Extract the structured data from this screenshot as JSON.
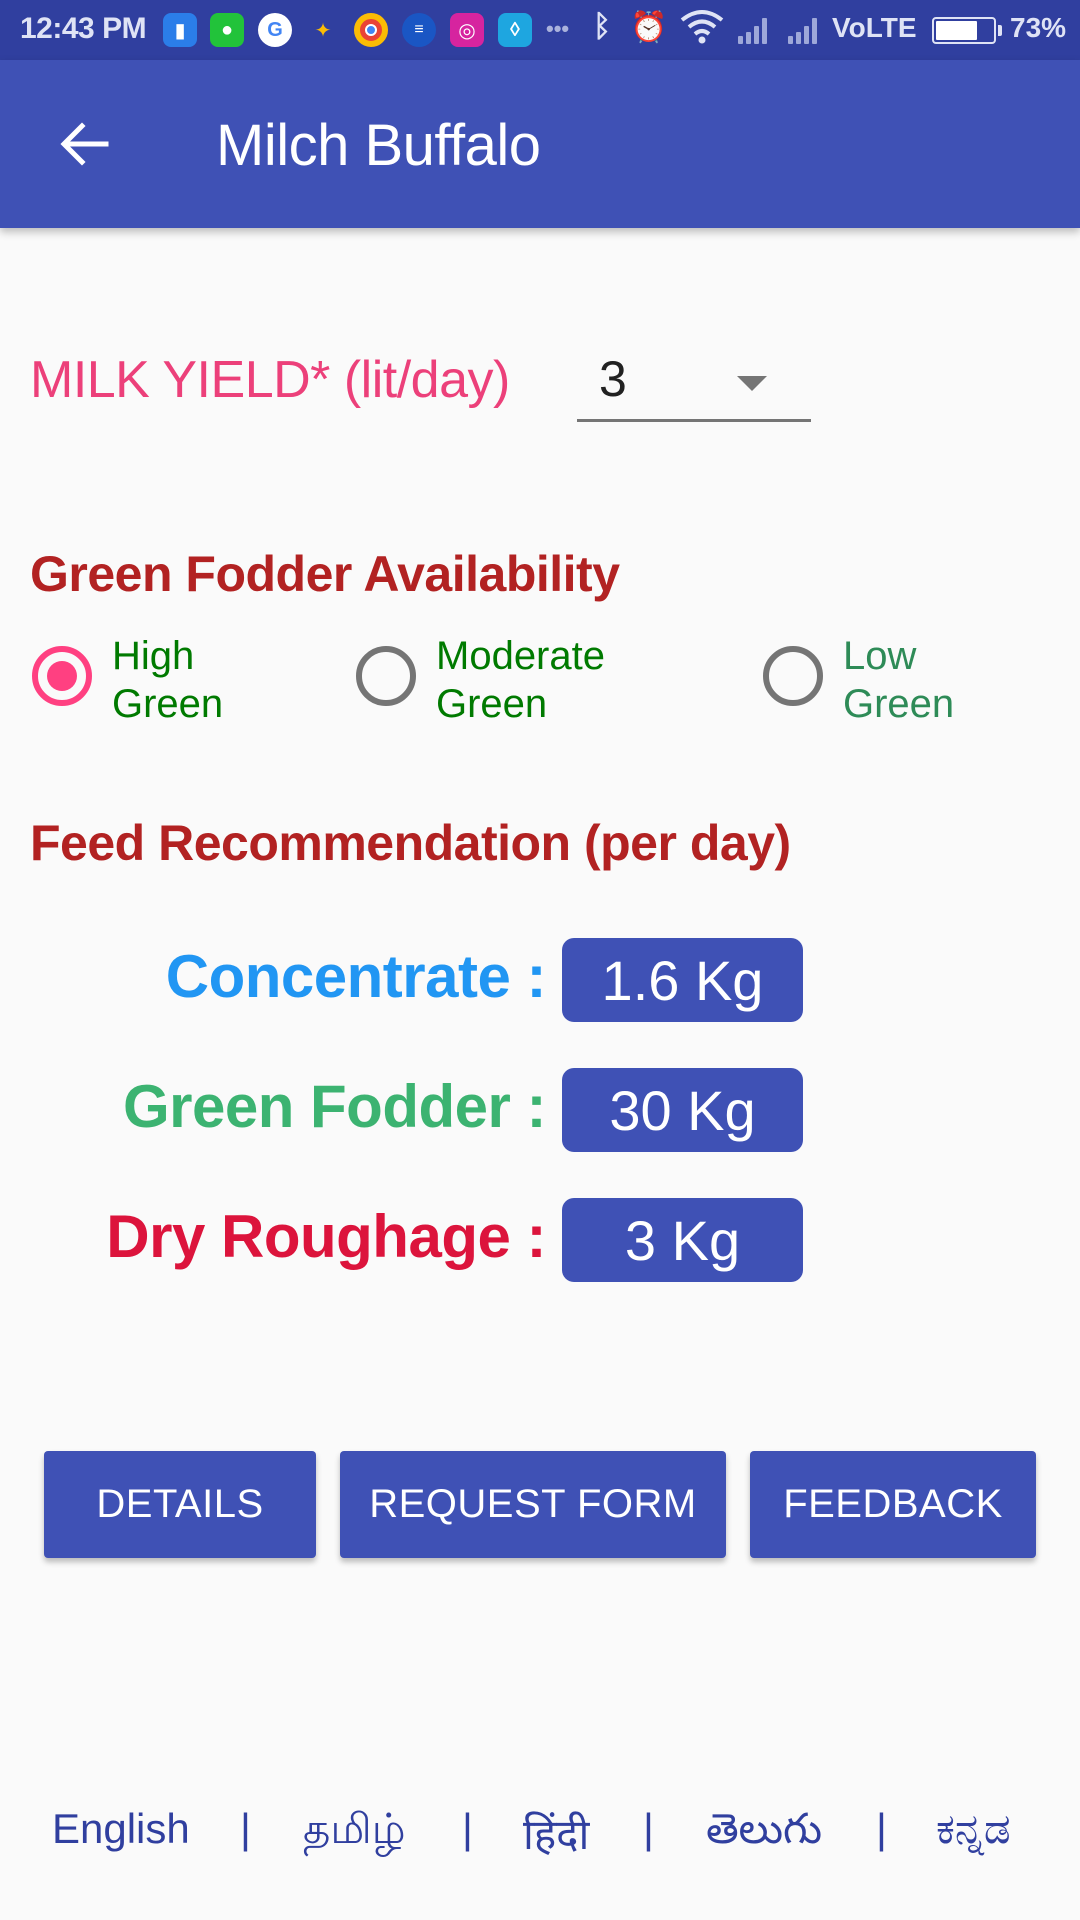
{
  "status_bar": {
    "time": "12:43 PM",
    "notification_icons": [
      "files-icon",
      "messages-icon",
      "google-icon",
      "photos-icon",
      "chrome-icon",
      "news-icon",
      "instagram-icon",
      "water-drop-icon"
    ],
    "more_label": "•••",
    "network_label": "VoLTE",
    "battery_percent_label": "73%",
    "battery_level": 0.73
  },
  "app_bar": {
    "title": "Milch Buffalo",
    "back_icon": "arrow-back-icon"
  },
  "milk_yield": {
    "label": "MILK YIELD* (lit/day)",
    "selected_value": "3"
  },
  "green_fodder": {
    "title": "Green Fodder Availability",
    "options": [
      {
        "line1": "High",
        "line2": "Green",
        "checked": true
      },
      {
        "line1": "Moderate",
        "line2": "Green",
        "checked": false
      },
      {
        "line1": "Low",
        "line2": "Green",
        "checked": false
      }
    ]
  },
  "feed": {
    "title": "Feed Recommendation (per day)",
    "rows": [
      {
        "label": "Concentrate :",
        "value": "1.6 Kg",
        "color": "#2196f3"
      },
      {
        "label": "Green Fodder :",
        "value": "30 Kg",
        "color": "#3cb371"
      },
      {
        "label": "Dry Roughage :",
        "value": "3 Kg",
        "color": "#dc143c"
      }
    ]
  },
  "buttons": {
    "details": "DETAILS",
    "request_form": "REQUEST FORM",
    "feedback": "FEEDBACK"
  },
  "languages": {
    "items": [
      "English",
      "தமிழ்",
      "हिंदी",
      "తెలుగు",
      "ಕನ್ನಡ"
    ],
    "separator": "|"
  },
  "colors": {
    "primary": "#3f51b5",
    "primary_dark": "#303f9f",
    "accent": "#ff4081"
  }
}
